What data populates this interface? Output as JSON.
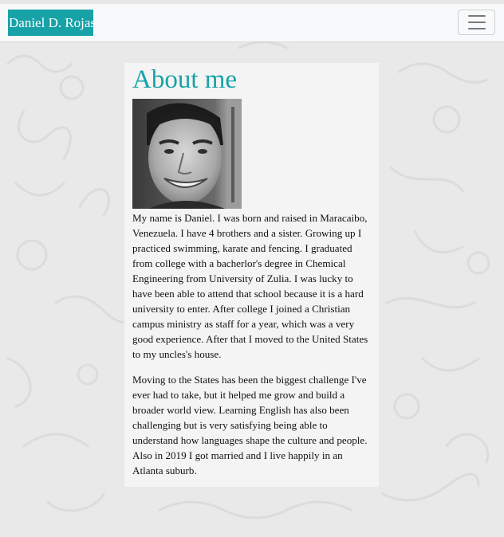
{
  "navbar": {
    "brand": "Daniel D. Rojas",
    "toggle_icon": "hamburger-menu-icon"
  },
  "about": {
    "heading": "About me",
    "photo_icon": "profile-photo",
    "paragraphs": [
      "My name is Daniel. I was born and raised in Maracaibo, Venezuela. I have 4 brothers and a sister. Growing up I practiced swimming, karate and fencing. I graduated from college with a bacherlor's degree in Chemical Engineering from University of Zulia. I was lucky to have been able to attend that school because it is a hard university to enter. After college I joined a Christian campus ministry as staff for a year, which was a very good experience. After that I moved to the United States to my uncles's house.",
      "Moving to the States has been the biggest challenge I've ever had to take, but it helped me grow and build a broader world view. Learning English has also been challenging but is very satisfying being able to understand how languages shape the culture and people. Also in 2019 I got married and I live happily in an Atlanta suburb."
    ]
  },
  "colors": {
    "accent": "#17a2a8",
    "navbar_bg": "#f8f9fa",
    "card_bg": "#f4f4f4",
    "page_bg": "#e9e9e9"
  }
}
